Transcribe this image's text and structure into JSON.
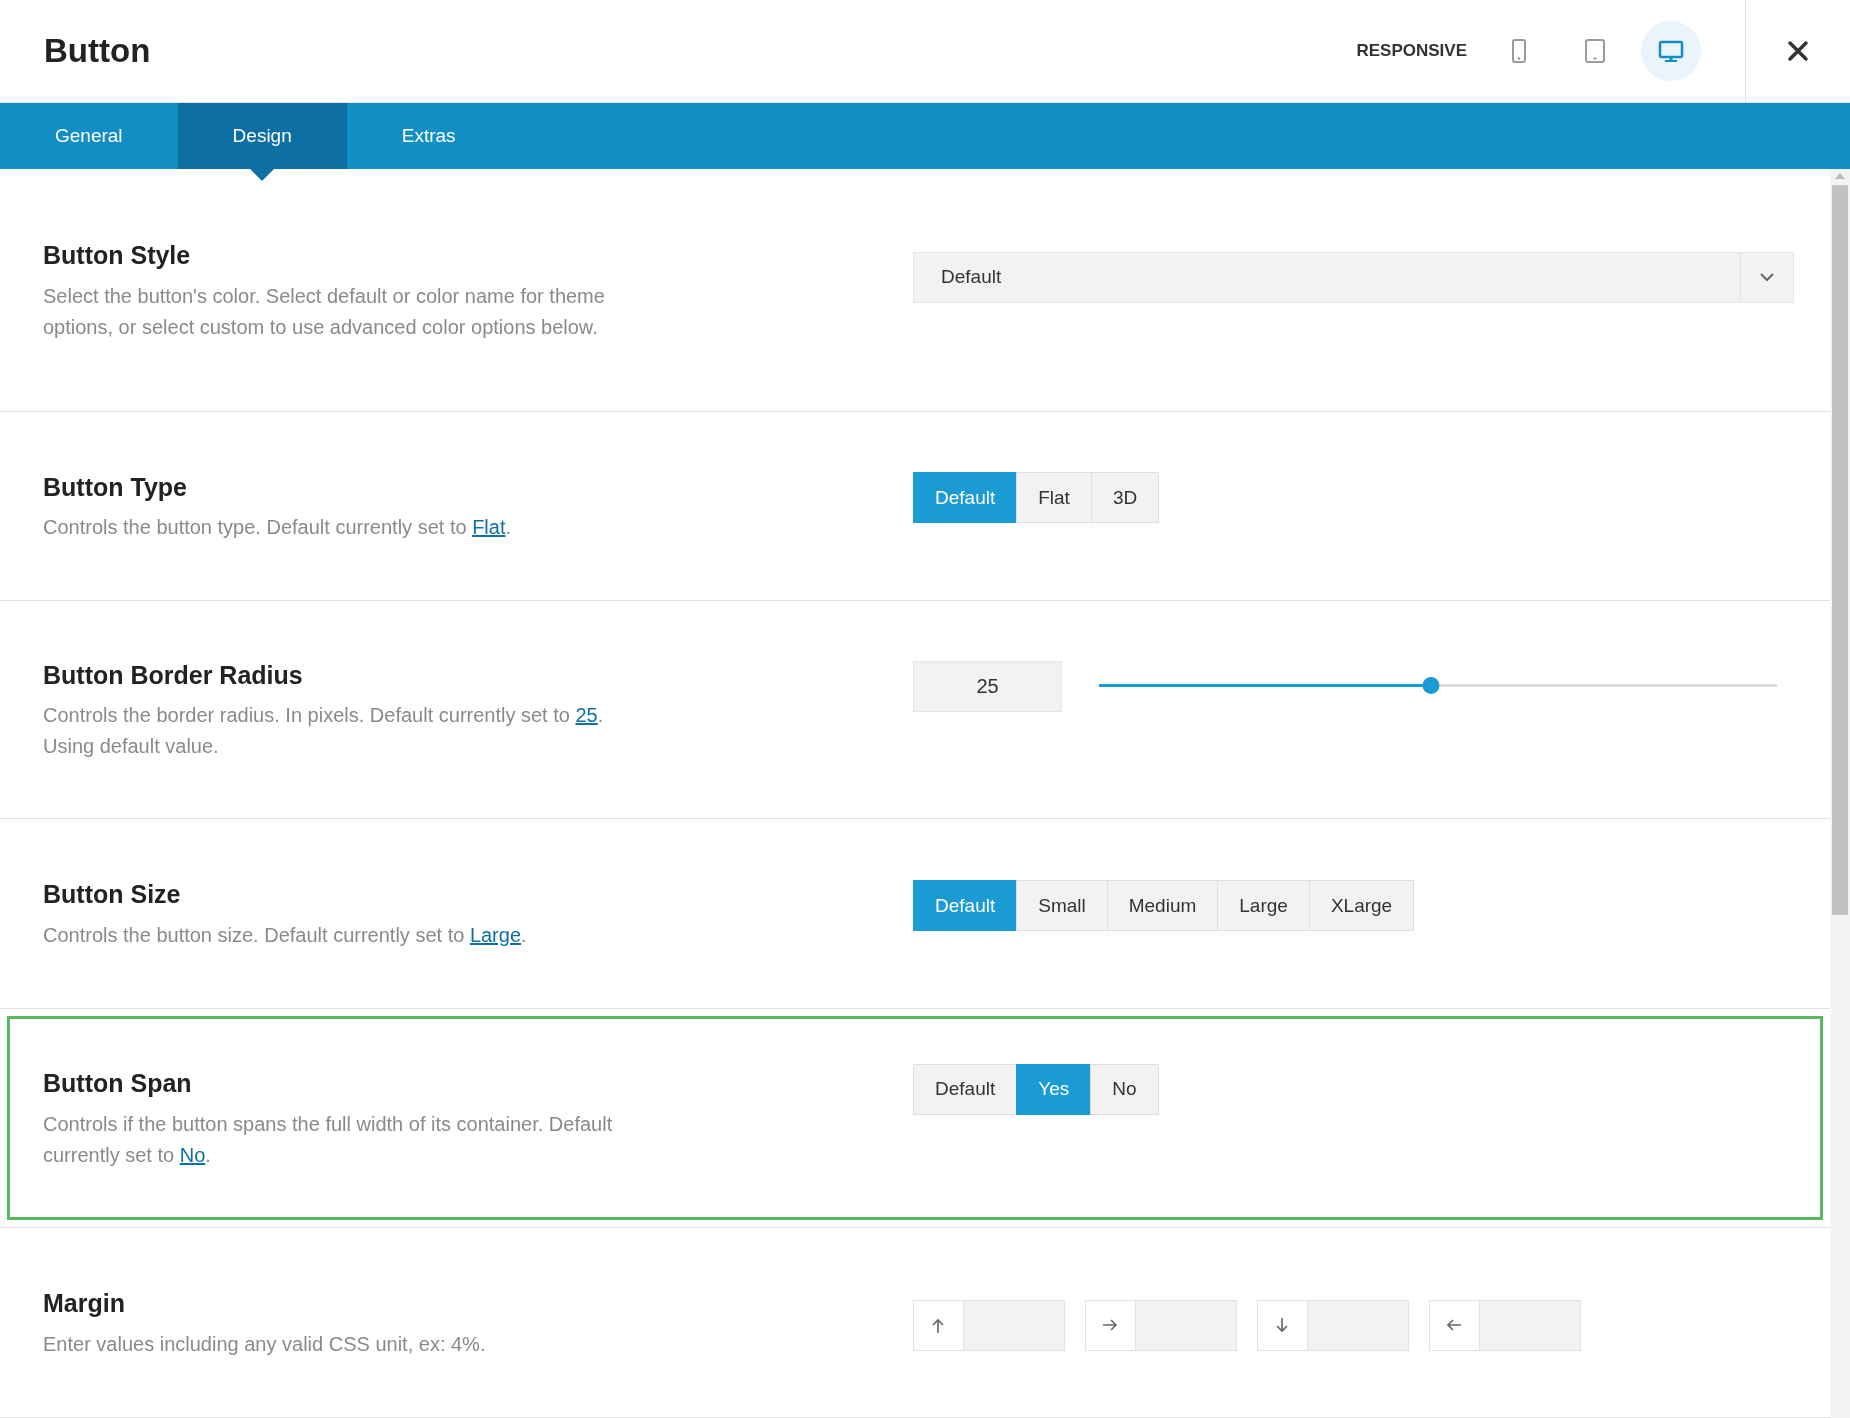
{
  "header": {
    "title": "Button",
    "responsive_label": "RESPONSIVE",
    "devices": [
      {
        "kind": "mobile",
        "selected": false
      },
      {
        "kind": "tablet",
        "selected": false
      },
      {
        "kind": "desktop",
        "selected": true
      }
    ]
  },
  "tabs": [
    {
      "label": "General",
      "selected": false
    },
    {
      "label": "Design",
      "selected": true
    },
    {
      "label": "Extras",
      "selected": false
    }
  ],
  "settings": [
    {
      "kind": "select",
      "title": "Button Style",
      "description": "Select the button's color. Select default or color name for theme options, or select custom to use advanced color options below.",
      "highlighted": false,
      "value": "Default"
    },
    {
      "kind": "buttonset",
      "title": "Button Type",
      "description": "Controls the button type. Default currently set to ",
      "link": "Flat",
      "suffix": ".",
      "highlighted": false,
      "options": [
        {
          "label": "Default",
          "selected": true
        },
        {
          "label": "Flat",
          "selected": false
        },
        {
          "label": "3D",
          "selected": false
        }
      ]
    },
    {
      "kind": "slider",
      "title": "Button Border Radius",
      "description": "Controls the border radius. In pixels. Default currently set to ",
      "link": "25",
      "suffix": ".",
      "note": "Using default value.",
      "highlighted": false,
      "value": "25",
      "level": 0.49
    },
    {
      "kind": "buttonset",
      "title": "Button Size",
      "description": "Controls the button size. Default currently set to ",
      "link": "Large",
      "suffix": ".",
      "highlighted": false,
      "options": [
        {
          "label": "Default",
          "selected": true
        },
        {
          "label": "Small",
          "selected": false
        },
        {
          "label": "Medium",
          "selected": false
        },
        {
          "label": "Large",
          "selected": false
        },
        {
          "label": "XLarge",
          "selected": false
        }
      ]
    },
    {
      "kind": "buttonset",
      "title": "Button Span",
      "description": "Controls if the button spans the full width of its container. Default currently set to ",
      "link": "No",
      "suffix": ".",
      "highlighted": true,
      "options": [
        {
          "label": "Default",
          "selected": false
        },
        {
          "label": "Yes",
          "selected": true
        },
        {
          "label": "No",
          "selected": false
        }
      ]
    },
    {
      "kind": "dimensions",
      "title": "Margin",
      "description": "Enter values including any valid CSS unit, ex: 4%.",
      "highlighted": false,
      "fields": [
        {
          "kind": "up"
        },
        {
          "kind": "right"
        },
        {
          "kind": "down"
        },
        {
          "kind": "left"
        }
      ]
    }
  ]
}
